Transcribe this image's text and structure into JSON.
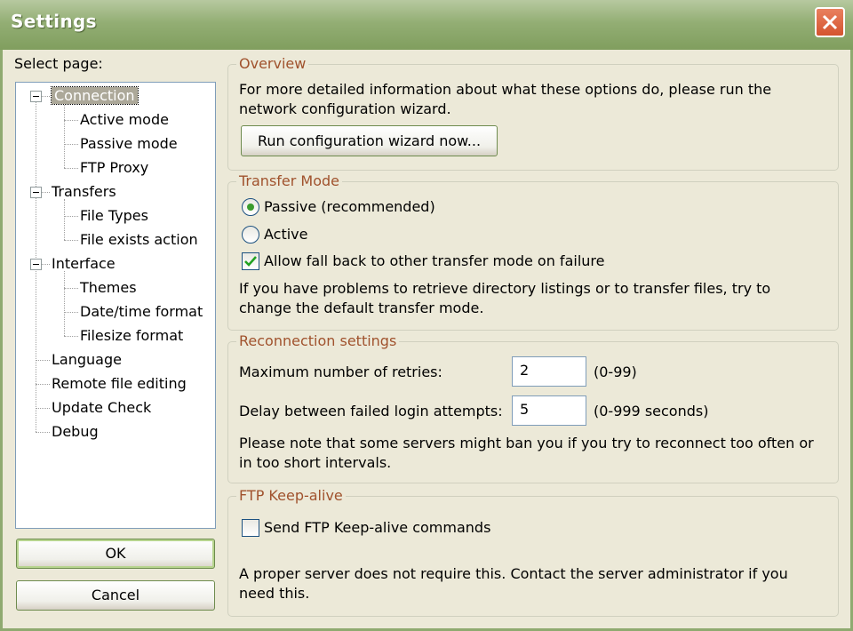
{
  "window": {
    "title": "Settings"
  },
  "tree": {
    "label": "Select page:",
    "items": [
      {
        "label": "Connection",
        "level": 0,
        "expanded": true,
        "selected": true
      },
      {
        "label": "Active mode",
        "level": 1
      },
      {
        "label": "Passive mode",
        "level": 1
      },
      {
        "label": "FTP Proxy",
        "level": 1
      },
      {
        "label": "Transfers",
        "level": 0,
        "expanded": true
      },
      {
        "label": "File Types",
        "level": 1
      },
      {
        "label": "File exists action",
        "level": 1
      },
      {
        "label": "Interface",
        "level": 0,
        "expanded": true
      },
      {
        "label": "Themes",
        "level": 1
      },
      {
        "label": "Date/time format",
        "level": 1
      },
      {
        "label": "Filesize format",
        "level": 1
      },
      {
        "label": "Language",
        "level": 0
      },
      {
        "label": "Remote file editing",
        "level": 0
      },
      {
        "label": "Update Check",
        "level": 0
      },
      {
        "label": "Debug",
        "level": 0
      }
    ]
  },
  "buttons": {
    "ok": "OK",
    "cancel": "Cancel"
  },
  "overview": {
    "legend": "Overview",
    "line1": "For more detailed information about what these options do, please run the",
    "line2": "network configuration wizard.",
    "wizard_button": "Run configuration wizard now..."
  },
  "transfer_mode": {
    "legend": "Transfer Mode",
    "passive_label": "Passive (recommended)",
    "passive_checked": true,
    "active_label": "Active",
    "active_checked": false,
    "fallback_label": "Allow fall back to other transfer mode on failure",
    "fallback_checked": true,
    "note1": "If you have problems to retrieve directory listings or to transfer files, try to",
    "note2": "change the default transfer mode."
  },
  "reconnection": {
    "legend": "Reconnection settings",
    "retries_label": "Maximum number of retries:",
    "retries_value": "2",
    "retries_range": "(0-99)",
    "delay_label": "Delay between failed login attempts:",
    "delay_value": "5",
    "delay_range": "(0-999 seconds)",
    "note1": "Please note that some servers might ban you if you try to reconnect too often or",
    "note2": "in too short intervals."
  },
  "keepalive": {
    "legend": "FTP Keep-alive",
    "checkbox_label": "Send FTP Keep-alive commands",
    "checked": false,
    "note1": "A proper server does not require this. Contact the server administrator if you",
    "note2": "need this."
  },
  "colors": {
    "title_bar": "#93AE74",
    "legend_text": "#A0522D",
    "radio_dot": "#3B9C2E",
    "close_button": "#D4542F"
  }
}
